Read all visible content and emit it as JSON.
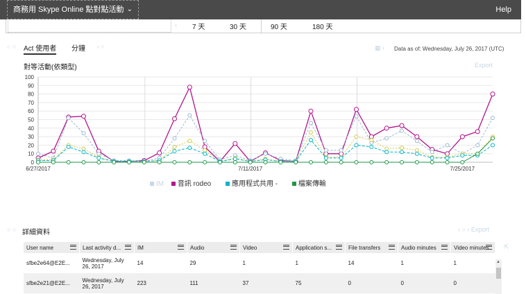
{
  "topbar": {
    "report_dropdown": "商務用 Skype Online 點對點活動",
    "help": "Help"
  },
  "ranges": [
    "7 天",
    "30 天",
    "90 天",
    "180 天"
  ],
  "view_tabs": [
    "Act 使用者",
    "分鐘"
  ],
  "data_as_of": "Data as of: Wednesday, July 26, 2017 (UTC)",
  "chart_title": "對等活動(依類型)",
  "export_ghost": "Export",
  "legend": [
    {
      "label": "IM",
      "color": "#c8d6e6"
    },
    {
      "label": "音訊 rodeo",
      "color": "#b4148c"
    },
    {
      "label": "應用程式共用 -",
      "color": "#00b4c8"
    },
    {
      "label": "檔案傳輸",
      "color": "#1e9646"
    }
  ],
  "chart_data": {
    "type": "line",
    "title": "對等活動(依類型)",
    "ylim": [
      0,
      100
    ],
    "yticks": [
      0,
      10,
      20,
      30,
      40,
      50,
      60,
      70,
      80,
      90,
      100
    ],
    "xtick_labels": [
      "6/27/2017",
      "7/11/2017",
      "7/25/2017"
    ],
    "xtick_index": [
      0,
      14,
      28
    ],
    "x_count": 31,
    "series": [
      {
        "name": "音訊 rodeo",
        "color": "#b4148c",
        "values": [
          5,
          13,
          53,
          54,
          13,
          1,
          1,
          2,
          11,
          51,
          88,
          18,
          1,
          22,
          1,
          11,
          2,
          1,
          60,
          10,
          10,
          62,
          30,
          40,
          43,
          30,
          15,
          10,
          30,
          36,
          80
        ]
      },
      {
        "name": "IM",
        "color": "#9ab8d0",
        "values": [
          10,
          5,
          52,
          34,
          10,
          2,
          2,
          1,
          5,
          28,
          55,
          25,
          3,
          8,
          2,
          10,
          4,
          2,
          46,
          14,
          14,
          54,
          23,
          28,
          37,
          25,
          12,
          20,
          10,
          20,
          52
        ]
      },
      {
        "name": "應用程式共用 -",
        "color": "#d4c84a",
        "values": [
          3,
          3,
          20,
          16,
          6,
          1,
          1,
          1,
          2,
          18,
          25,
          14,
          1,
          5,
          1,
          4,
          1,
          1,
          35,
          6,
          6,
          30,
          26,
          16,
          17,
          14,
          6,
          6,
          10,
          10,
          30
        ]
      },
      {
        "name": "檔案傳輸",
        "color": "#00b4c8",
        "values": [
          2,
          2,
          18,
          12,
          5,
          1,
          1,
          1,
          2,
          13,
          17,
          10,
          1,
          4,
          1,
          3,
          1,
          1,
          26,
          5,
          5,
          20,
          18,
          12,
          12,
          10,
          5,
          5,
          8,
          8,
          20
        ]
      },
      {
        "name": "",
        "color": "#1e9646",
        "values": [
          0,
          0,
          0,
          0,
          0,
          0,
          0,
          0,
          0,
          0,
          0,
          0,
          0,
          0,
          0,
          0,
          0,
          0,
          0,
          0,
          0,
          0,
          0,
          0,
          0,
          0,
          0,
          0,
          0,
          10,
          28
        ]
      }
    ]
  },
  "details_title": "詳細資料",
  "table": {
    "columns": [
      "User name",
      "Last activity d...",
      "IM",
      "Audio",
      "Video",
      "Application s...",
      "File transfers",
      "Audio minutes",
      "Video minutes"
    ],
    "rows": [
      [
        "sfbe2e64@E2E...",
        "Wednesday, July 26, 2017",
        "14",
        "29",
        "1",
        "1",
        "14",
        "1",
        "1"
      ],
      [
        "sfbe2e21@E2E...",
        "Wednesday, July 26, 2017",
        "223",
        "111",
        "37",
        "75",
        "0",
        "0",
        "0"
      ]
    ]
  }
}
